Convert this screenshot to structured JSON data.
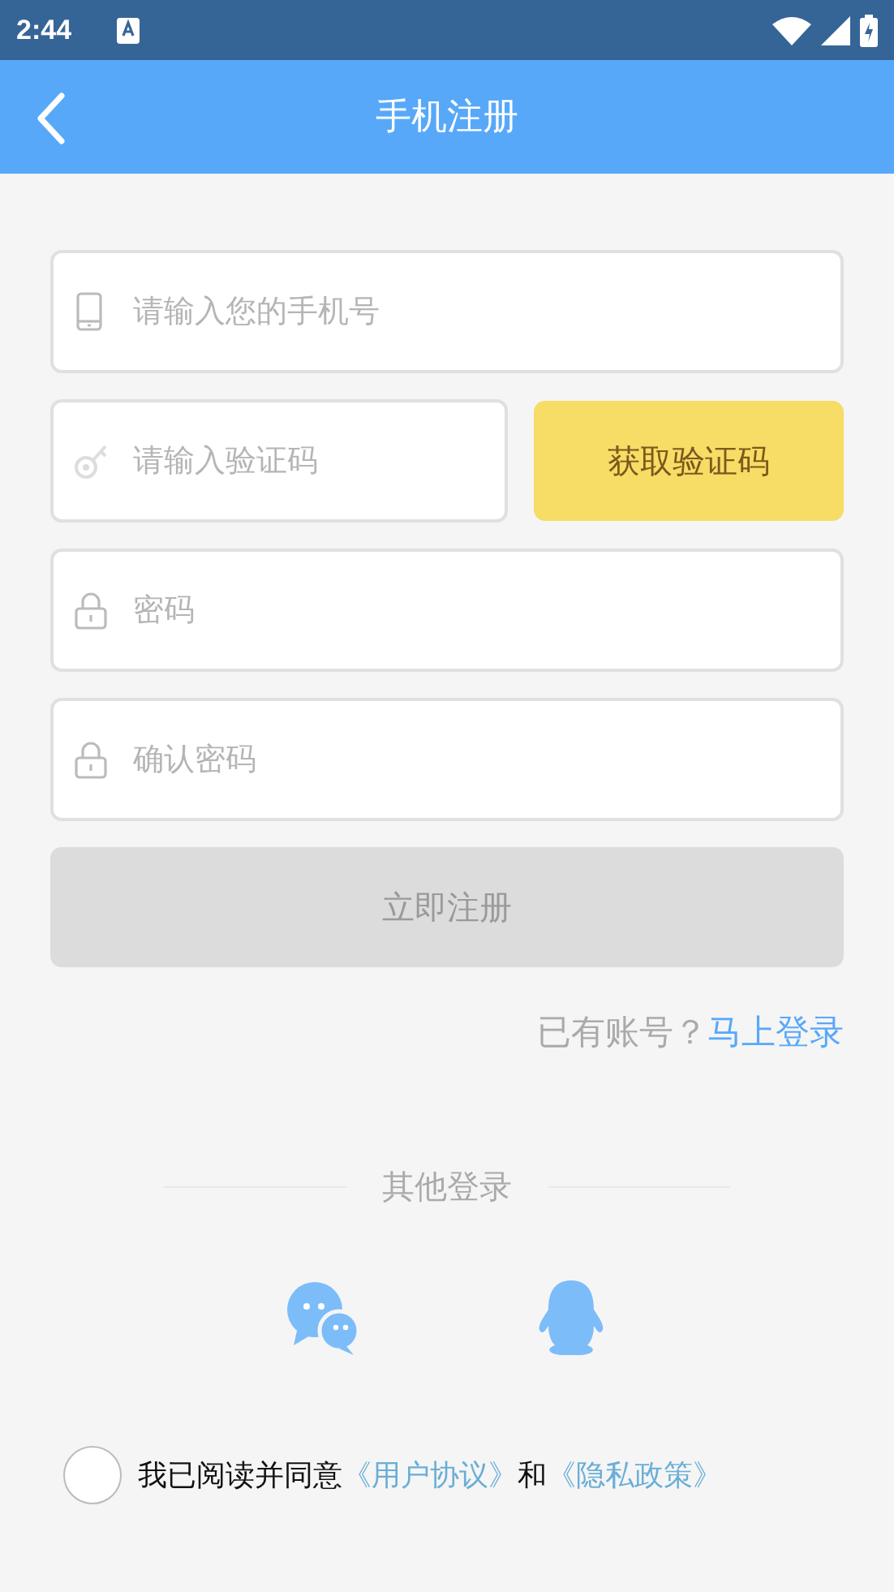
{
  "status_bar": {
    "time": "2:44"
  },
  "header": {
    "title": "手机注册"
  },
  "fields": [
    {
      "kind": "phone",
      "placeholder": "请输入您的手机号"
    },
    {
      "kind": "code",
      "placeholder": "请输入验证码",
      "button": "获取验证码"
    },
    {
      "kind": "password",
      "placeholder": "密码"
    },
    {
      "kind": "password",
      "placeholder": "确认密码"
    }
  ],
  "register_button": {
    "label": "立即注册",
    "disabled": true
  },
  "login_prompt": {
    "text": "已有账号？",
    "link": "马上登录"
  },
  "other_login": {
    "title": "其他登录",
    "providers": [
      {
        "kind": "chat"
      },
      {
        "kind": "penguin"
      }
    ]
  },
  "agreement": {
    "checked": false,
    "text": "我已阅读并同意",
    "link_1": "《用户协议》",
    "joiner": "和",
    "link_2": "《隐私政策》"
  }
}
